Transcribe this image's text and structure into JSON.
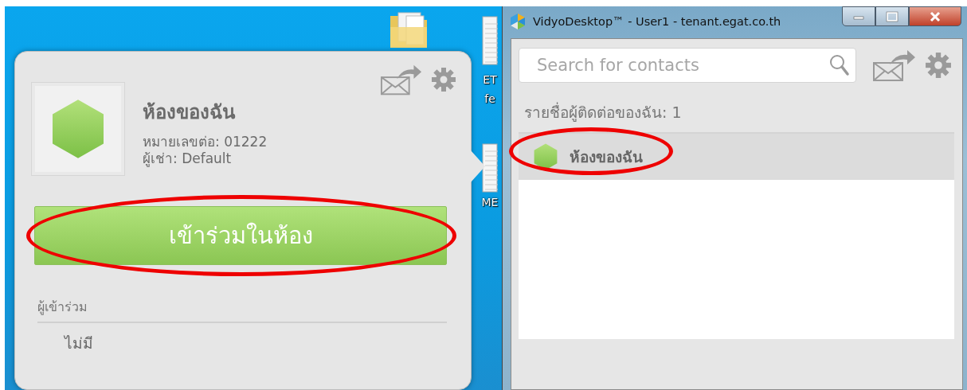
{
  "desktop": {
    "icons": [
      {
        "kind": "folder"
      },
      {
        "kind": "document",
        "label_lines": [
          "ET",
          "fe"
        ]
      },
      {
        "kind": "document",
        "label_lines": [
          "ME"
        ]
      }
    ]
  },
  "room_popup": {
    "name": "ห้องของฉัน",
    "extension": "หมายเลขต่อ: 01222",
    "tenant": "ผู้เช่า: Default",
    "join_button": {
      "label": "เข้าร่วมในห้อง",
      "highlighted": true
    },
    "participants_heading": "ผู้เข้าร่วม",
    "participants_empty": "ไม่มี"
  },
  "window": {
    "title": "VidyoDesktop™  - User1 - tenant.egat.co.th",
    "search": {
      "placeholder": "Search for contacts"
    },
    "contacts_heading": "รายชื่อผู้ติดต่อของฉัน: 1",
    "contacts": [
      {
        "name": "ห้องของฉัน",
        "selected": true,
        "highlighted": true
      }
    ]
  }
}
